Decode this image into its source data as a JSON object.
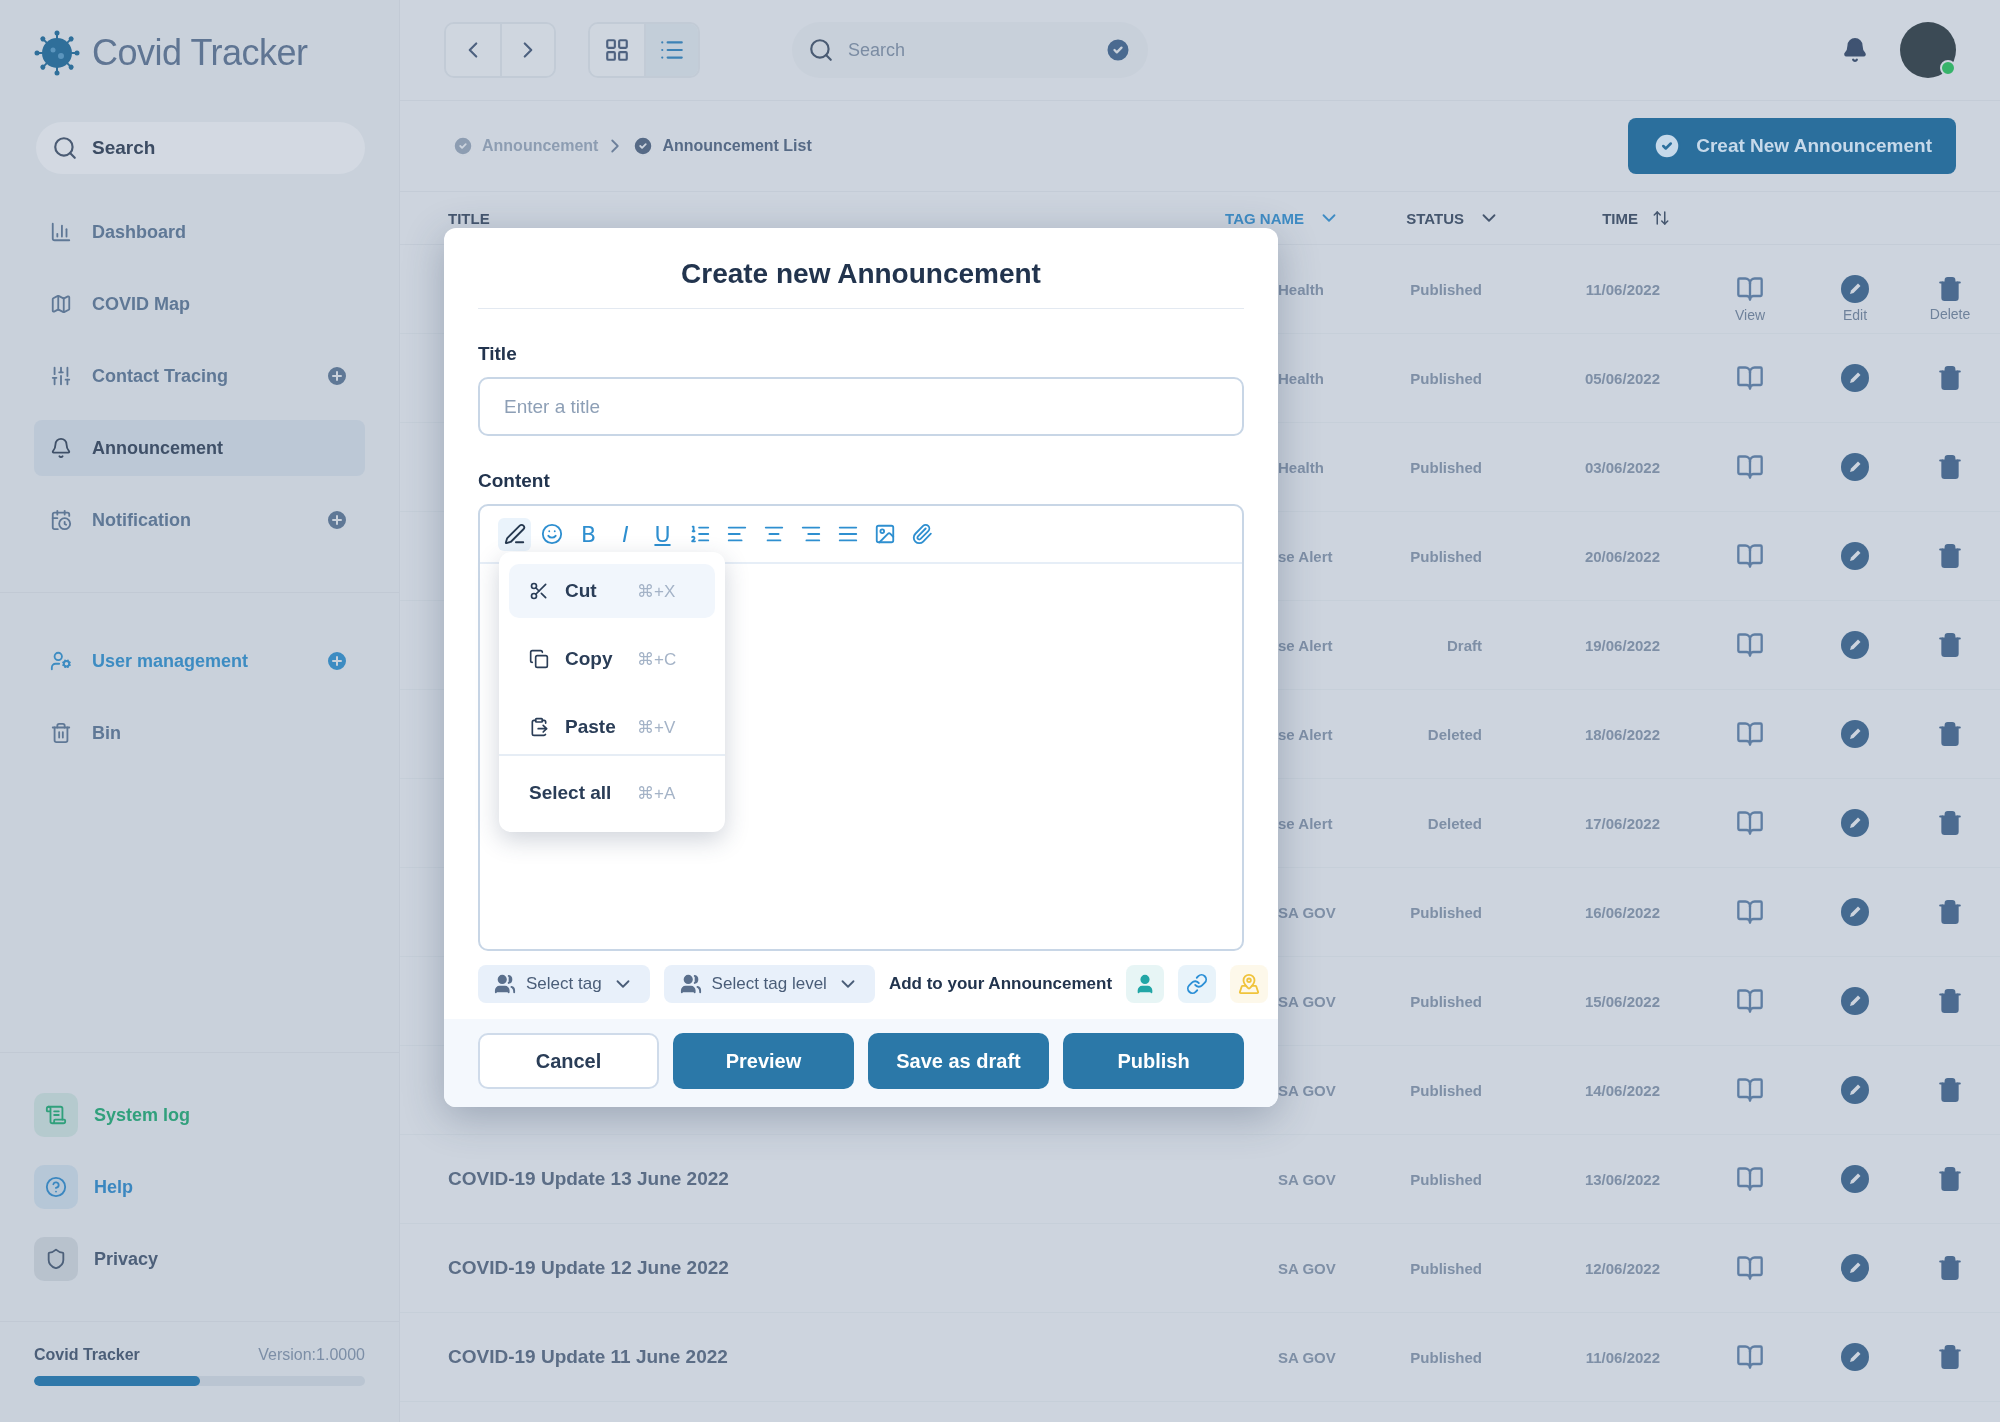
{
  "sidebar": {
    "app_name": "Covid Tracker",
    "search": {
      "placeholder": "Search"
    },
    "nav_items": [
      {
        "label": "Dashboard",
        "selected": false,
        "add": false,
        "color": "#5f7896"
      },
      {
        "label": "COVID Map",
        "selected": false,
        "add": false,
        "color": "#5f7896"
      },
      {
        "label": "Contact Tracing",
        "selected": false,
        "add": true,
        "color": "#5f7896"
      },
      {
        "label": "Announcement",
        "selected": true,
        "add": false,
        "color": "#3f5068"
      },
      {
        "label": "Notification",
        "selected": false,
        "add": true,
        "color": "#5f7896"
      }
    ],
    "admin_items": [
      {
        "label": "User management",
        "selected": false,
        "add": true,
        "color": "#3d8cc2"
      },
      {
        "label": "Bin",
        "selected": false,
        "add": false,
        "color": "#5f7896"
      }
    ],
    "bottom_items": [
      {
        "label": "System log",
        "color": "#31a07c"
      },
      {
        "label": "Help",
        "color": "#3b87c0"
      },
      {
        "label": "Privacy",
        "color": "#4d607a"
      }
    ],
    "footer": {
      "name": "Covid Tracker",
      "version": "Version:1.0000",
      "level": 0.5
    }
  },
  "topbar": {
    "view_modes": [
      {
        "kind": "grid",
        "selected": false
      },
      {
        "kind": "list",
        "selected": true
      }
    ],
    "search": {
      "placeholder": "Search"
    }
  },
  "breadcrumb": [
    "Announcement",
    "Announcement List"
  ],
  "create_button": "Creat New Announcement",
  "table": {
    "columns": [
      {
        "label": "TITLE",
        "active": false
      },
      {
        "label": "TAG NAME",
        "active": true
      },
      {
        "label": "STATUS",
        "active": false
      },
      {
        "label": "TIME",
        "active": false
      }
    ],
    "rows": [
      {
        "tag": "Health",
        "status": "Published",
        "time": "11/06/2022",
        "action_labels": [
          "View",
          "Edit",
          "Delete"
        ]
      },
      {
        "tag": "Health",
        "status": "Published",
        "time": "05/06/2022"
      },
      {
        "tag": "Health",
        "status": "Published",
        "time": "03/06/2022"
      },
      {
        "tag": "se Alert",
        "status": "Published",
        "time": "20/06/2022"
      },
      {
        "tag": "se Alert",
        "status": "Draft",
        "time": "19/06/2022"
      },
      {
        "tag": "se Alert",
        "status": "Deleted",
        "time": "18/06/2022"
      },
      {
        "tag": "se Alert",
        "status": "Deleted",
        "time": "17/06/2022"
      },
      {
        "tag": "SA GOV",
        "status": "Published",
        "time": "16/06/2022"
      },
      {
        "tag": "SA GOV",
        "status": "Published",
        "time": "15/06/2022"
      },
      {
        "tag": "SA GOV",
        "status": "Published",
        "time": "14/06/2022"
      },
      {
        "title": "COVID-19 Update 13 June 2022",
        "tag": "SA GOV",
        "status": "Published",
        "time": "13/06/2022"
      },
      {
        "title": "COVID-19 Update 12 June 2022",
        "tag": "SA GOV",
        "status": "Published",
        "time": "12/06/2022"
      },
      {
        "title": "COVID-19 Update 11 June 2022",
        "tag": "SA GOV",
        "status": "Published",
        "time": "11/06/2022"
      }
    ]
  },
  "modal": {
    "title": "Create new Announcement",
    "title_label": "Title",
    "title_placeholder": "Enter a title",
    "content_label": "Content",
    "toolbar": [
      {
        "kind": "pen",
        "selected": true
      },
      {
        "kind": "emoji",
        "selected": false
      },
      {
        "kind": "bold",
        "label": "B",
        "selected": false
      },
      {
        "kind": "italic",
        "label": "I",
        "selected": false
      },
      {
        "kind": "underline",
        "label": "U",
        "selected": false
      },
      {
        "kind": "list",
        "selected": false
      },
      {
        "kind": "align-left",
        "selected": false
      },
      {
        "kind": "align-center",
        "selected": false
      },
      {
        "kind": "align-right",
        "selected": false
      },
      {
        "kind": "justify",
        "selected": false
      },
      {
        "kind": "image",
        "selected": false
      },
      {
        "kind": "attach",
        "selected": false
      }
    ],
    "context_menu": [
      {
        "kind": "cut",
        "label": "Cut",
        "shortcut": "⌘+X",
        "selected": true
      },
      {
        "kind": "copy",
        "label": "Copy",
        "shortcut": "⌘+C",
        "selected": false
      },
      {
        "kind": "paste",
        "label": "Paste",
        "shortcut": "⌘+V",
        "selected": false
      },
      {
        "kind": "select",
        "label": "Select all",
        "shortcut": "⌘+A",
        "selected": false
      }
    ],
    "tag_select": "Select tag",
    "tag_level_select": "Select tag level",
    "add_label": "Add to your Announcement",
    "add_options": [
      {
        "kind": "person",
        "color": "#22a6a6"
      },
      {
        "kind": "link",
        "color": "#2b8fd6"
      },
      {
        "kind": "map",
        "color": "#f0c33c"
      }
    ],
    "buttons": [
      {
        "label": "Cancel",
        "kind": "secondary"
      },
      {
        "label": "Preview",
        "kind": "primary"
      },
      {
        "label": "Save as draft",
        "kind": "primary"
      },
      {
        "label": "Publish",
        "kind": "primary"
      }
    ]
  }
}
